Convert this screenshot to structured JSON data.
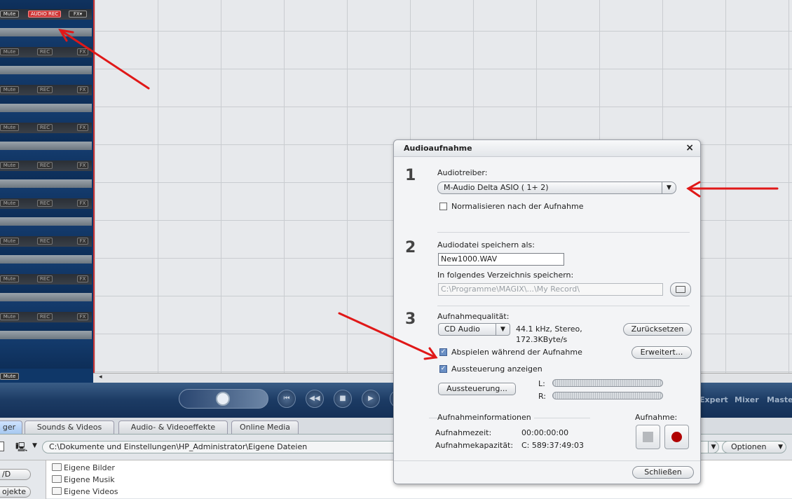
{
  "tracks": {
    "first_mute": "Mute",
    "first_rec": "AUDIO REC",
    "fx": "FX",
    "mute": "Mute",
    "rec": "REC",
    "last_mute": "Mute"
  },
  "transport": {
    "labels": [
      "Expert",
      "Mixer",
      "Master"
    ]
  },
  "tabs": [
    "ger",
    "Sounds & Videos",
    "Audio- & Videoeffekte",
    "Online Media"
  ],
  "pathbar": {
    "path": "C:\\Dokumente und Einstellungen\\HP_Administrator\\Eigene Dateien",
    "options": "Optionen"
  },
  "files": {
    "left_buttons": [
      "/D",
      "ojekte"
    ],
    "folders": [
      "Eigene Bilder",
      "Eigene Musik",
      "Eigene Videos"
    ]
  },
  "dialog": {
    "title": "Audioaufnahme",
    "close": "×",
    "sections": {
      "s1": {
        "number": "1",
        "driver_label": "Audiotreiber:",
        "driver_value": "M-Audio Delta ASIO ( 1+ 2)",
        "normalize_label": "Normalisieren nach der Aufnahme"
      },
      "s2": {
        "number": "2",
        "file_label": "Audiodatei speichern als:",
        "file_value": "New1000.WAV",
        "dir_label": "In folgendes Verzeichnis speichern:",
        "dir_value": "C:\\Programme\\MAGIX\\...\\My Record\\"
      },
      "s3": {
        "number": "3",
        "quality_label": "Aufnahmequalität:",
        "quality_value": "CD Audio",
        "quality_info_1": "44.1 kHz, Stereo,",
        "quality_info_2": "172.3KByte/s",
        "reset": "Zurücksetzen",
        "play_label": "Abspielen während der Aufnahme",
        "advanced": "Erweitert...",
        "level_label": "Aussteuerung anzeigen",
        "level_button": "Aussteuerung...",
        "left": "L:",
        "right": "R:"
      }
    },
    "info": {
      "header": "Aufnahmeinformationen",
      "time_label": "Aufnahmezeit:",
      "time_value": "00:00:00:00",
      "capacity_label": "Aufnahmekapazität:",
      "capacity_value": "C: 589:37:49:03",
      "rec_label": "Aufnahme:"
    },
    "close_button": "Schließen"
  },
  "colors": {
    "arrow": "#e01818",
    "track_panel": "#0f3768",
    "record": "#b00000"
  }
}
